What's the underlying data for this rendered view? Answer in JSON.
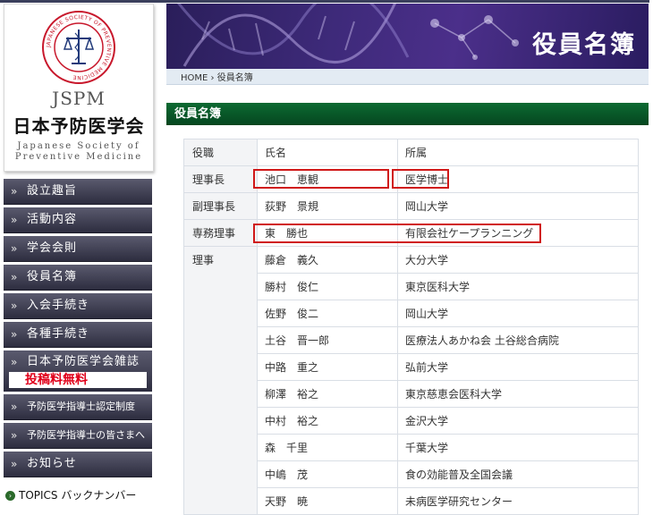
{
  "site": {
    "abbr": "JSPM",
    "name_jp": "日本予防医学会",
    "name_en_line1": "Japanese Society of",
    "name_en_line2": "Preventive Medicine",
    "seal_text": "JAPANESE SOCIETY OF PREVENTIVE MEDICINE"
  },
  "nav": {
    "items": [
      {
        "label": "設立趣旨"
      },
      {
        "label": "活動内容"
      },
      {
        "label": "学会会則"
      },
      {
        "label": "役員名簿"
      },
      {
        "label": "入会手続き"
      },
      {
        "label": "各種手続き"
      }
    ],
    "journal": {
      "label": "日本予防医学会雑誌",
      "badge": "投稿料無料"
    },
    "items2": [
      {
        "label": "予防医学指導士認定制度"
      },
      {
        "label": "予防医学指導士の皆さまへ"
      },
      {
        "label": "お知らせ"
      }
    ],
    "topics": "TOPICS バックナンバー",
    "arrow": "»"
  },
  "page": {
    "banner_title": "役員名簿",
    "breadcrumb": "HOME › 役員名簿",
    "section_title": "役員名簿"
  },
  "table": {
    "headers": [
      "役職",
      "氏名",
      "所属"
    ],
    "rows": [
      {
        "role": "理事長",
        "name": "池口　恵観",
        "affiliation": "医学博士",
        "highlighted": true
      },
      {
        "role": "副理事長",
        "name": "荻野　景規",
        "affiliation": "岡山大学"
      },
      {
        "role": "専務理事",
        "name": "東　勝也",
        "affiliation": "有限会社ケープランニング",
        "highlighted": true
      },
      {
        "role": "理事",
        "name": "藤倉　義久",
        "affiliation": "大分大学"
      },
      {
        "role": "",
        "name": "勝村　俊仁",
        "affiliation": "東京医科大学"
      },
      {
        "role": "",
        "name": "佐野　俊二",
        "affiliation": "岡山大学"
      },
      {
        "role": "",
        "name": "土谷　晋一郎",
        "affiliation": "医療法人あかね会 土谷総合病院"
      },
      {
        "role": "",
        "name": "中路　重之",
        "affiliation": "弘前大学"
      },
      {
        "role": "",
        "name": "柳澤　裕之",
        "affiliation": "東京慈恵会医科大学"
      },
      {
        "role": "",
        "name": "中村　裕之",
        "affiliation": "金沢大学"
      },
      {
        "role": "",
        "name": "森　千里",
        "affiliation": "千葉大学"
      },
      {
        "role": "",
        "name": "中嶋　茂",
        "affiliation": "食の効能普及全国会議"
      },
      {
        "role": "",
        "name": "天野　暁",
        "affiliation": "未病医学研究センター"
      }
    ]
  },
  "colors": {
    "nav_bg": "#3a3a4e",
    "banner_bg": "#3e2a7a",
    "section_green": "#0c6a32",
    "highlight_red": "#d01818",
    "badge_red": "#e0001a"
  }
}
